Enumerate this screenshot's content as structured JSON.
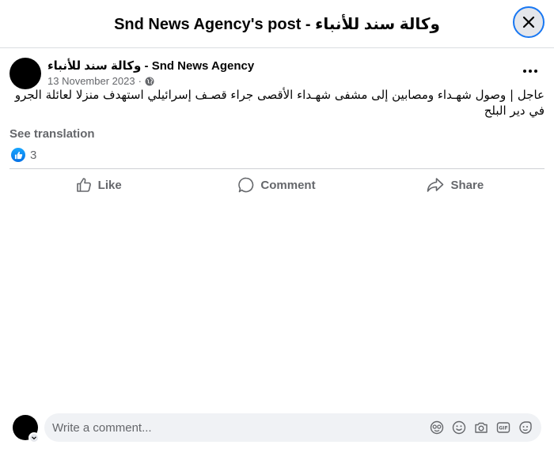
{
  "header": {
    "title": "Snd News Agency's post - وكالة سند للأنباء"
  },
  "post": {
    "author": "وكالة سند للأنباء - Snd News Agency",
    "date": "13 November 2023",
    "separator": "·",
    "audience_icon": "globe-icon",
    "text": "عاجل | وصول شهـداء ومصابين إلى مشفى شهـداء الأقصى جراء قصـف إسرائيلي استهدف منزلا لعائلة الجرو في دير البلح",
    "see_translation": "See translation",
    "reaction_count": "3"
  },
  "actions": {
    "like": "Like",
    "comment": "Comment",
    "share": "Share"
  },
  "comment_bar": {
    "placeholder": "Write a comment...",
    "icons": [
      "avatar-sticker-icon",
      "emoji-icon",
      "camera-icon",
      "gif-icon",
      "sticker-icon"
    ]
  },
  "colors": {
    "accent": "#1877f2",
    "secondary_text": "#65676b",
    "divider": "#ced0d4"
  }
}
